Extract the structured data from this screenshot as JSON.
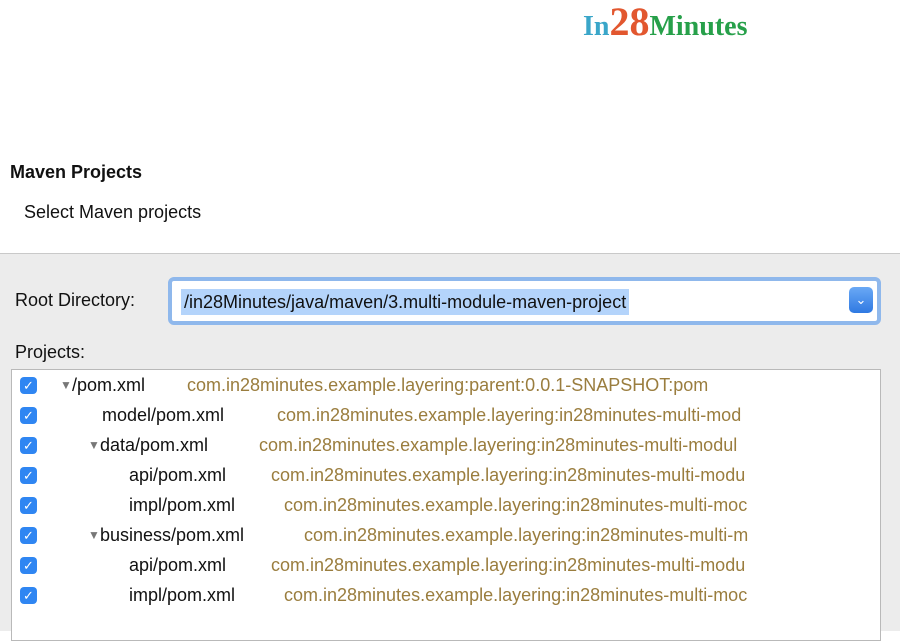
{
  "logo": {
    "part1": "In",
    "part2": "28",
    "part3": "Minutes"
  },
  "header": {
    "title": "Maven Projects",
    "subtitle": "Select Maven projects"
  },
  "root": {
    "label": "Root Directory:",
    "value": "/in28Minutes/java/maven/3.multi-module-maven-project"
  },
  "projects_label": "Projects:",
  "projects": [
    {
      "name": "/pom.xml",
      "coords": "com.in28minutes.example.layering:parent:0.0.1-SNAPSHOT:pom",
      "checked": true,
      "expandable": true
    },
    {
      "name": "model/pom.xml",
      "coords": "com.in28minutes.example.layering:in28minutes-multi-mod",
      "checked": true,
      "expandable": false
    },
    {
      "name": "data/pom.xml",
      "coords": "com.in28minutes.example.layering:in28minutes-multi-modul",
      "checked": true,
      "expandable": true
    },
    {
      "name": "api/pom.xml",
      "coords": "com.in28minutes.example.layering:in28minutes-multi-modu",
      "checked": true,
      "expandable": false
    },
    {
      "name": "impl/pom.xml",
      "coords": "com.in28minutes.example.layering:in28minutes-multi-moc",
      "checked": true,
      "expandable": false
    },
    {
      "name": "business/pom.xml",
      "coords": "com.in28minutes.example.layering:in28minutes-multi-m",
      "checked": true,
      "expandable": true
    },
    {
      "name": "api/pom.xml",
      "coords": "com.in28minutes.example.layering:in28minutes-multi-modu",
      "checked": true,
      "expandable": false
    },
    {
      "name": "impl/pom.xml",
      "coords": "com.in28minutes.example.layering:in28minutes-multi-moc",
      "checked": true,
      "expandable": false
    }
  ],
  "icons": {
    "checkbox": "checkmark-icon",
    "expand": "triangle-down-icon",
    "dropdown": "chevron-down-icon"
  },
  "colors": {
    "coords": "#9a7d3e",
    "selection": "#b4d4fb",
    "checkbox": "#2f86f2",
    "logo_in": "#3aa6c9",
    "logo_28": "#e2572f",
    "logo_minutes": "#27a04a"
  }
}
